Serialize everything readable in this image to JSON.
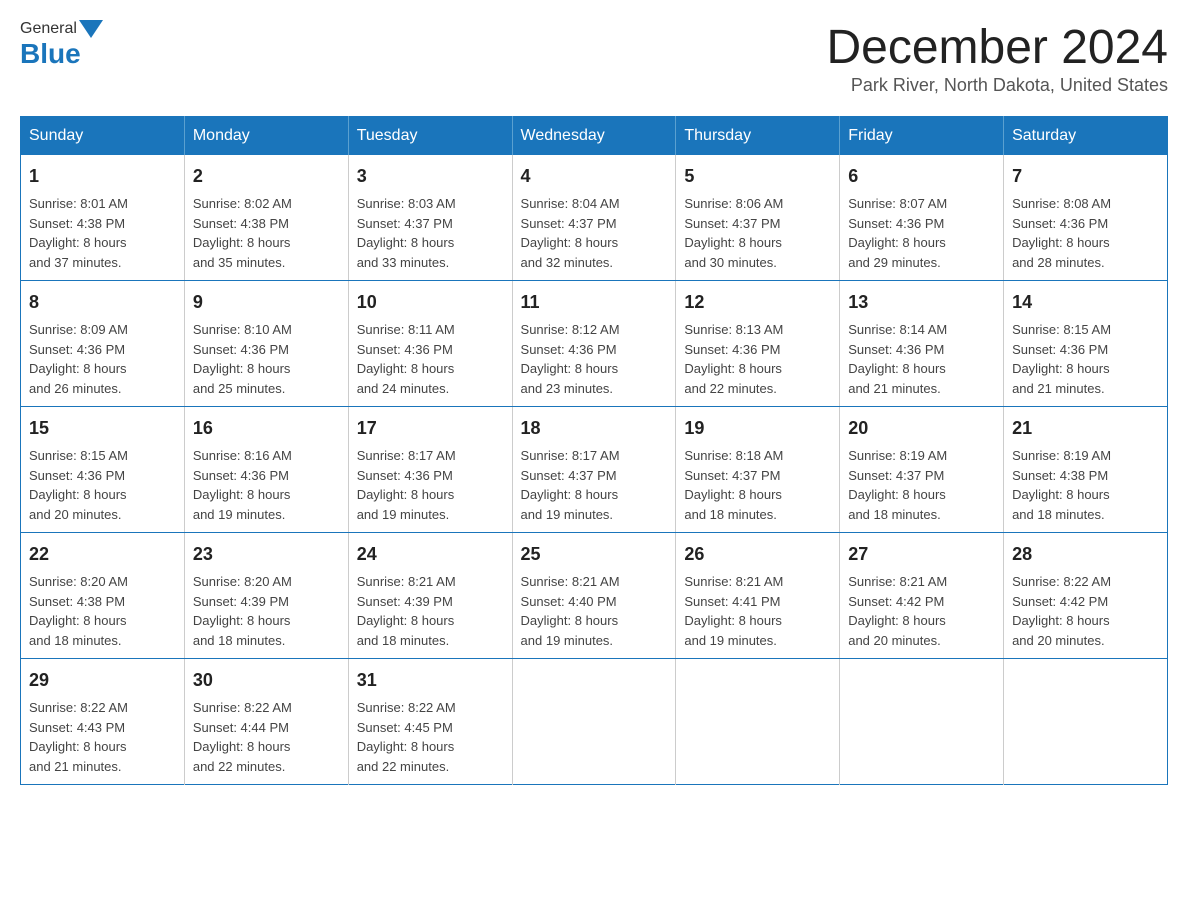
{
  "logo": {
    "general": "General",
    "blue": "Blue"
  },
  "title": {
    "month_year": "December 2024",
    "location": "Park River, North Dakota, United States"
  },
  "weekdays": [
    "Sunday",
    "Monday",
    "Tuesday",
    "Wednesday",
    "Thursday",
    "Friday",
    "Saturday"
  ],
  "weeks": [
    [
      {
        "day": "1",
        "sunrise": "8:01 AM",
        "sunset": "4:38 PM",
        "daylight": "8 hours and 37 minutes."
      },
      {
        "day": "2",
        "sunrise": "8:02 AM",
        "sunset": "4:38 PM",
        "daylight": "8 hours and 35 minutes."
      },
      {
        "day": "3",
        "sunrise": "8:03 AM",
        "sunset": "4:37 PM",
        "daylight": "8 hours and 33 minutes."
      },
      {
        "day": "4",
        "sunrise": "8:04 AM",
        "sunset": "4:37 PM",
        "daylight": "8 hours and 32 minutes."
      },
      {
        "day": "5",
        "sunrise": "8:06 AM",
        "sunset": "4:37 PM",
        "daylight": "8 hours and 30 minutes."
      },
      {
        "day": "6",
        "sunrise": "8:07 AM",
        "sunset": "4:36 PM",
        "daylight": "8 hours and 29 minutes."
      },
      {
        "day": "7",
        "sunrise": "8:08 AM",
        "sunset": "4:36 PM",
        "daylight": "8 hours and 28 minutes."
      }
    ],
    [
      {
        "day": "8",
        "sunrise": "8:09 AM",
        "sunset": "4:36 PM",
        "daylight": "8 hours and 26 minutes."
      },
      {
        "day": "9",
        "sunrise": "8:10 AM",
        "sunset": "4:36 PM",
        "daylight": "8 hours and 25 minutes."
      },
      {
        "day": "10",
        "sunrise": "8:11 AM",
        "sunset": "4:36 PM",
        "daylight": "8 hours and 24 minutes."
      },
      {
        "day": "11",
        "sunrise": "8:12 AM",
        "sunset": "4:36 PM",
        "daylight": "8 hours and 23 minutes."
      },
      {
        "day": "12",
        "sunrise": "8:13 AM",
        "sunset": "4:36 PM",
        "daylight": "8 hours and 22 minutes."
      },
      {
        "day": "13",
        "sunrise": "8:14 AM",
        "sunset": "4:36 PM",
        "daylight": "8 hours and 21 minutes."
      },
      {
        "day": "14",
        "sunrise": "8:15 AM",
        "sunset": "4:36 PM",
        "daylight": "8 hours and 21 minutes."
      }
    ],
    [
      {
        "day": "15",
        "sunrise": "8:15 AM",
        "sunset": "4:36 PM",
        "daylight": "8 hours and 20 minutes."
      },
      {
        "day": "16",
        "sunrise": "8:16 AM",
        "sunset": "4:36 PM",
        "daylight": "8 hours and 19 minutes."
      },
      {
        "day": "17",
        "sunrise": "8:17 AM",
        "sunset": "4:36 PM",
        "daylight": "8 hours and 19 minutes."
      },
      {
        "day": "18",
        "sunrise": "8:17 AM",
        "sunset": "4:37 PM",
        "daylight": "8 hours and 19 minutes."
      },
      {
        "day": "19",
        "sunrise": "8:18 AM",
        "sunset": "4:37 PM",
        "daylight": "8 hours and 18 minutes."
      },
      {
        "day": "20",
        "sunrise": "8:19 AM",
        "sunset": "4:37 PM",
        "daylight": "8 hours and 18 minutes."
      },
      {
        "day": "21",
        "sunrise": "8:19 AM",
        "sunset": "4:38 PM",
        "daylight": "8 hours and 18 minutes."
      }
    ],
    [
      {
        "day": "22",
        "sunrise": "8:20 AM",
        "sunset": "4:38 PM",
        "daylight": "8 hours and 18 minutes."
      },
      {
        "day": "23",
        "sunrise": "8:20 AM",
        "sunset": "4:39 PM",
        "daylight": "8 hours and 18 minutes."
      },
      {
        "day": "24",
        "sunrise": "8:21 AM",
        "sunset": "4:39 PM",
        "daylight": "8 hours and 18 minutes."
      },
      {
        "day": "25",
        "sunrise": "8:21 AM",
        "sunset": "4:40 PM",
        "daylight": "8 hours and 19 minutes."
      },
      {
        "day": "26",
        "sunrise": "8:21 AM",
        "sunset": "4:41 PM",
        "daylight": "8 hours and 19 minutes."
      },
      {
        "day": "27",
        "sunrise": "8:21 AM",
        "sunset": "4:42 PM",
        "daylight": "8 hours and 20 minutes."
      },
      {
        "day": "28",
        "sunrise": "8:22 AM",
        "sunset": "4:42 PM",
        "daylight": "8 hours and 20 minutes."
      }
    ],
    [
      {
        "day": "29",
        "sunrise": "8:22 AM",
        "sunset": "4:43 PM",
        "daylight": "8 hours and 21 minutes."
      },
      {
        "day": "30",
        "sunrise": "8:22 AM",
        "sunset": "4:44 PM",
        "daylight": "8 hours and 22 minutes."
      },
      {
        "day": "31",
        "sunrise": "8:22 AM",
        "sunset": "4:45 PM",
        "daylight": "8 hours and 22 minutes."
      },
      null,
      null,
      null,
      null
    ]
  ],
  "labels": {
    "sunrise": "Sunrise:",
    "sunset": "Sunset:",
    "daylight": "Daylight:"
  }
}
